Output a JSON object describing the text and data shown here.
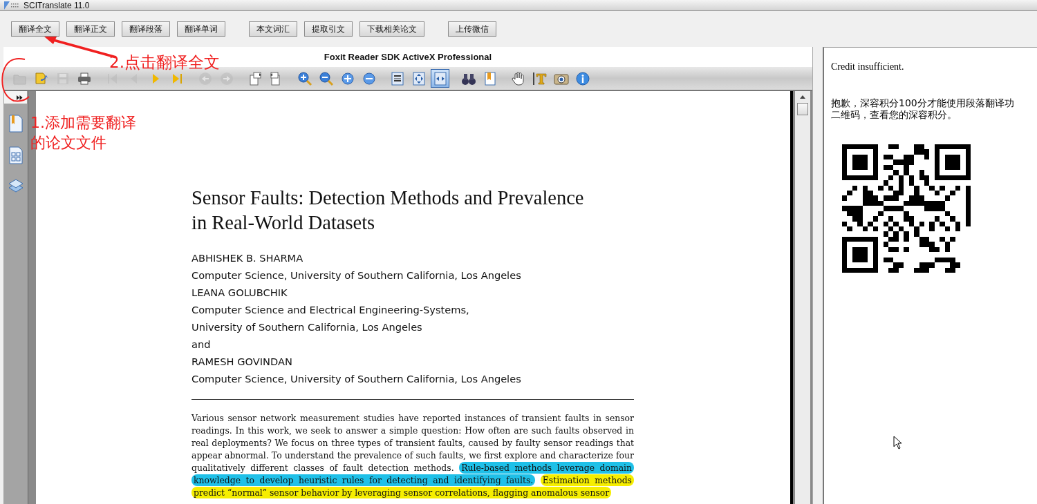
{
  "window": {
    "title": "SCITranslate 11.0"
  },
  "button_groups": [
    [
      "翻译全文",
      "翻译正文",
      "翻译段落",
      "翻译单词"
    ],
    [
      "本文词汇",
      "提取引文",
      "下载相关论文"
    ],
    [
      "上传微信"
    ]
  ],
  "viewer": {
    "title": "Foxit Reader SDK ActiveX Professional",
    "toolbar_groups": [
      [
        {
          "kind": "open",
          "disabled": true,
          "selected": false
        },
        {
          "kind": "open-file",
          "disabled": false,
          "selected": false
        },
        {
          "kind": "save",
          "disabled": true,
          "selected": false
        },
        {
          "kind": "print",
          "disabled": false,
          "selected": false
        }
      ],
      [
        {
          "kind": "first",
          "disabled": true,
          "selected": false
        },
        {
          "kind": "prev",
          "disabled": true,
          "selected": false
        },
        {
          "kind": "next",
          "disabled": false,
          "selected": false
        },
        {
          "kind": "last",
          "disabled": false,
          "selected": false
        }
      ],
      [
        {
          "kind": "back",
          "disabled": true,
          "selected": false
        },
        {
          "kind": "forward",
          "disabled": true,
          "selected": false
        }
      ],
      [
        {
          "kind": "rotate-cw",
          "disabled": false,
          "selected": false
        },
        {
          "kind": "rotate-ccw",
          "disabled": false,
          "selected": false
        }
      ],
      [
        {
          "kind": "zoom-in",
          "disabled": false,
          "selected": false
        },
        {
          "kind": "zoom-out",
          "disabled": false,
          "selected": false
        },
        {
          "kind": "plus",
          "disabled": false,
          "selected": false
        },
        {
          "kind": "minus",
          "disabled": false,
          "selected": false
        }
      ],
      [
        {
          "kind": "actual-size",
          "disabled": false,
          "selected": false
        },
        {
          "kind": "fit-page",
          "disabled": false,
          "selected": false
        },
        {
          "kind": "fit-width",
          "disabled": false,
          "selected": true
        }
      ],
      [
        {
          "kind": "find",
          "disabled": false,
          "selected": false
        },
        {
          "kind": "bookmark",
          "disabled": false,
          "selected": false
        }
      ],
      [
        {
          "kind": "hand",
          "disabled": false,
          "selected": false
        },
        {
          "kind": "text-select",
          "disabled": false,
          "selected": false
        },
        {
          "kind": "snapshot",
          "disabled": false,
          "selected": false
        },
        {
          "kind": "info",
          "disabled": false,
          "selected": false
        }
      ]
    ],
    "sidebar_tools": [
      {
        "kind": "bookmarks"
      },
      {
        "kind": "thumbnails"
      },
      {
        "kind": "layers"
      }
    ],
    "document": {
      "title_lines": [
        "Sensor Faults: Detection Methods and Prevalence",
        "in Real-World Datasets"
      ],
      "authors": [
        "ABHISHEK B. SHARMA",
        "Computer Science, University of Southern California, Los Angeles",
        "LEANA GOLUBCHIK",
        "Computer Science and Electrical Engineering-Systems,",
        "University of Southern California, Los Angeles",
        "and",
        "RAMESH GOVINDAN",
        "Computer Science, University of Southern California, Los Angeles"
      ],
      "abstract": [
        {
          "text": "Various sensor network measurement studies have reported instances of transient faults in sensor readings. In this work, we seek to answer a simple question: How often are such faults observed in real deployments? We focus on three types of transient faults, caused by faulty sensor readings that appear abnormal. To understand the prevalence of such faults, we first explore and characterize four qualitatively different classes of fault detection methods."
        },
        {
          "text": "Rule-based methods leverage domain knowledge to develop heuristic rules for detecting and identifying faults.",
          "color": "#1fc0e8"
        },
        {
          "text": "Estimation methods predict “normal” sensor behavior by leveraging sensor correlations, flagging anomalous sensor",
          "color": "#f6ee00"
        }
      ]
    }
  },
  "side_panel": {
    "message": "Credit insufficient.",
    "notice_lines": [
      "抱歉，深容积分100分才能使用段落翻译功",
      "二维码，查看您的深容积分。"
    ]
  },
  "annotations": {
    "step_2": "2.点击翻译全文",
    "step_1": [
      "1.添加需要翻译",
      "的论文文件"
    ]
  }
}
